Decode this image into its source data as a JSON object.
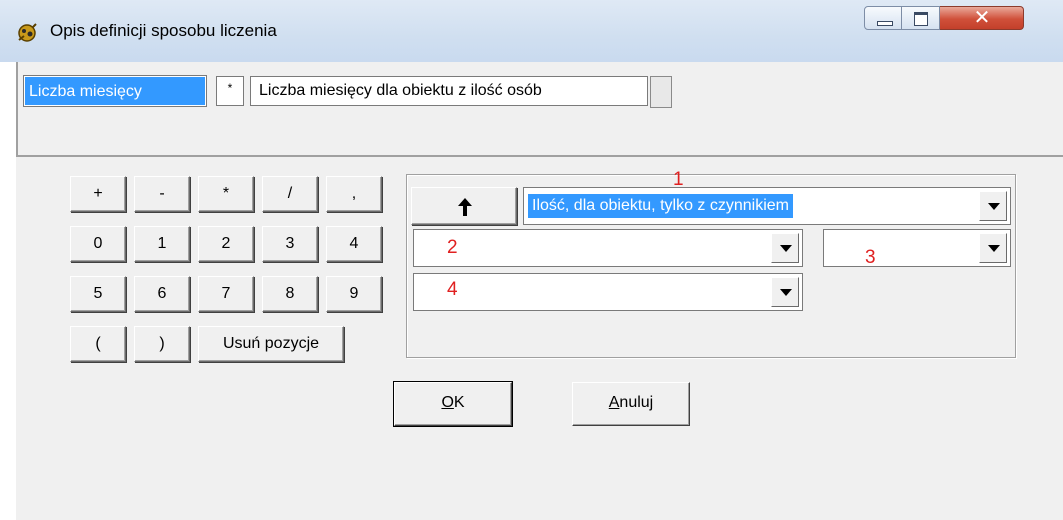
{
  "window": {
    "title": "Opis definicji sposobu liczenia",
    "icon": "app-icon",
    "controls": {
      "minimize": "minimize-icon",
      "maximize": "maximize-icon",
      "close": "✕"
    }
  },
  "formula_row": {
    "name_value": "Liczba miesięcy",
    "operator_value": "*",
    "description_value": "Liczba miesięcy dla obiektu z ilość osób"
  },
  "keypad": {
    "row1": [
      "+",
      "-",
      "*",
      "/",
      ","
    ],
    "row2": [
      "0",
      "1",
      "2",
      "3",
      "4"
    ],
    "row3": [
      "5",
      "6",
      "7",
      "8",
      "9"
    ],
    "row4": [
      "(",
      ")"
    ],
    "remove_label": "Usuń pozycje"
  },
  "panel": {
    "up_button_icon": "arrow-up-icon",
    "combo1_value": "Ilość, dla obiektu, tylko z czynnikiem",
    "combo2_value": "",
    "combo3_value": "",
    "combo4_value": "",
    "markers": {
      "m1": "1",
      "m2": "2",
      "m3": "3",
      "m4": "4"
    }
  },
  "buttons": {
    "ok_accel": "O",
    "ok_rest": "K",
    "cancel_accel": "A",
    "cancel_rest": "nuluj"
  },
  "colors": {
    "selection": "#3399ff",
    "marker": "#e02020"
  }
}
